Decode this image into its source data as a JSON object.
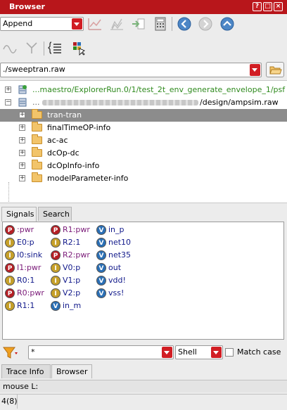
{
  "window": {
    "title": "Browser",
    "controls": [
      "?",
      "□",
      "×"
    ]
  },
  "toolbar": {
    "mode_select": "Append",
    "path_value": "./sweeptran.raw"
  },
  "tree": {
    "items": [
      {
        "label": "...maestro/ExplorerRun.0/1/test_2t_env_generate_envelope_1/psf",
        "color": "#2f8a1e"
      },
      {
        "label": "/design/ampsim.raw",
        "prefix": "..."
      },
      {
        "label": "tran-tran",
        "selected": true
      },
      {
        "label": "finalTimeOP-info"
      },
      {
        "label": "ac-ac"
      },
      {
        "label": "dcOp-dc"
      },
      {
        "label": "dcOpInfo-info"
      },
      {
        "label": "modelParameter-info"
      }
    ]
  },
  "tabs": [
    "Signals",
    "Search"
  ],
  "signals": {
    "col1": [
      {
        "badge": "P",
        "label": ":pwr",
        "kind": "p",
        "color": "purple"
      },
      {
        "badge": "I",
        "label": "E0:p",
        "kind": "i",
        "color": "blue"
      },
      {
        "badge": "I",
        "label": "I0:sink",
        "kind": "i",
        "color": "blue"
      },
      {
        "badge": "P",
        "label": "I1:pwr",
        "kind": "p",
        "color": "purple"
      },
      {
        "badge": "I",
        "label": "R0:1",
        "kind": "i",
        "color": "blue"
      },
      {
        "badge": "P",
        "label": "R0:pwr",
        "kind": "p",
        "color": "purple"
      },
      {
        "badge": "I",
        "label": "R1:1",
        "kind": "i",
        "color": "blue"
      }
    ],
    "col2": [
      {
        "badge": "P",
        "label": "R1:pwr",
        "kind": "p",
        "color": "purple"
      },
      {
        "badge": "I",
        "label": "R2:1",
        "kind": "i",
        "color": "blue"
      },
      {
        "badge": "P",
        "label": "R2:pwr",
        "kind": "p",
        "color": "purple"
      },
      {
        "badge": "I",
        "label": "V0:p",
        "kind": "i",
        "color": "blue"
      },
      {
        "badge": "I",
        "label": "V1:p",
        "kind": "i",
        "color": "blue"
      },
      {
        "badge": "I",
        "label": "V2:p",
        "kind": "i",
        "color": "blue"
      },
      {
        "badge": "V",
        "label": "in_m",
        "kind": "v",
        "color": "blue"
      }
    ],
    "col3": [
      {
        "badge": "V",
        "label": "in_p",
        "kind": "v",
        "color": "blue"
      },
      {
        "badge": "V",
        "label": "net10",
        "kind": "v",
        "color": "blue"
      },
      {
        "badge": "V",
        "label": "net35",
        "kind": "v",
        "color": "blue"
      },
      {
        "badge": "V",
        "label": "out",
        "kind": "v",
        "color": "blue"
      },
      {
        "badge": "V",
        "label": "vdd!",
        "kind": "v",
        "color": "blue"
      },
      {
        "badge": "V",
        "label": "vss!",
        "kind": "v",
        "color": "blue"
      }
    ]
  },
  "filter": {
    "pattern": "*",
    "syntax": "Shell",
    "match_case_label": "Match case"
  },
  "bottom_tabs": [
    "Trace Info",
    "Browser"
  ],
  "mouse_label": "mouse L:",
  "status_text": "4(8)",
  "colors": {
    "accent": "#b8161b",
    "selection": "#8c8c8c"
  }
}
